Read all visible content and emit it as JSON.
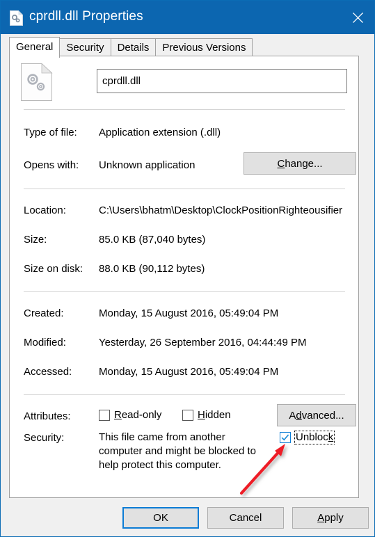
{
  "window": {
    "title": "cprdll.dll Properties",
    "icon": "dll-file-icon",
    "close_label": "✕"
  },
  "tabs": [
    {
      "label": "General",
      "active": true
    },
    {
      "label": "Security",
      "active": false
    },
    {
      "label": "Details",
      "active": false
    },
    {
      "label": "Previous Versions",
      "active": false
    }
  ],
  "general": {
    "filename_value": "cprdll.dll",
    "rows": [
      {
        "label": "Type of file:",
        "value": "Application extension (.dll)"
      },
      {
        "label": "Opens with:",
        "value": "Unknown application"
      },
      {
        "label": "Location:",
        "value": "C:\\Users\\bhatm\\Desktop\\ClockPositionRighteousifier"
      },
      {
        "label": "Size:",
        "value": "85.0 KB (87,040 bytes)"
      },
      {
        "label": "Size on disk:",
        "value": "88.0 KB (90,112 bytes)"
      },
      {
        "label": "Created:",
        "value": "Monday, 15 August 2016, 05:49:04 PM"
      },
      {
        "label": "Modified:",
        "value": "Yesterday, 26 September 2016, 04:44:49 PM"
      },
      {
        "label": "Accessed:",
        "value": "Monday, 15 August 2016, 05:49:04 PM"
      }
    ],
    "change_button": "Change...",
    "attributes_label": "Attributes:",
    "readonly_label": "Read-only",
    "hidden_label": "Hidden",
    "advanced_button": "Advanced...",
    "security_label": "Security:",
    "security_text": "This file came from another computer and might be blocked to help protect this computer.",
    "unblock_label": "Unblock",
    "unblock_checked": true,
    "readonly_checked": false,
    "hidden_checked": false
  },
  "footer": {
    "ok": "OK",
    "cancel": "Cancel",
    "apply": "Apply"
  },
  "colors": {
    "titlebar": "#0c66b0",
    "accent": "#0c7cd5",
    "annotation_arrow": "#ee1c25",
    "panel_bg": "#ffffff",
    "dialog_bg": "#f0f0f0"
  }
}
